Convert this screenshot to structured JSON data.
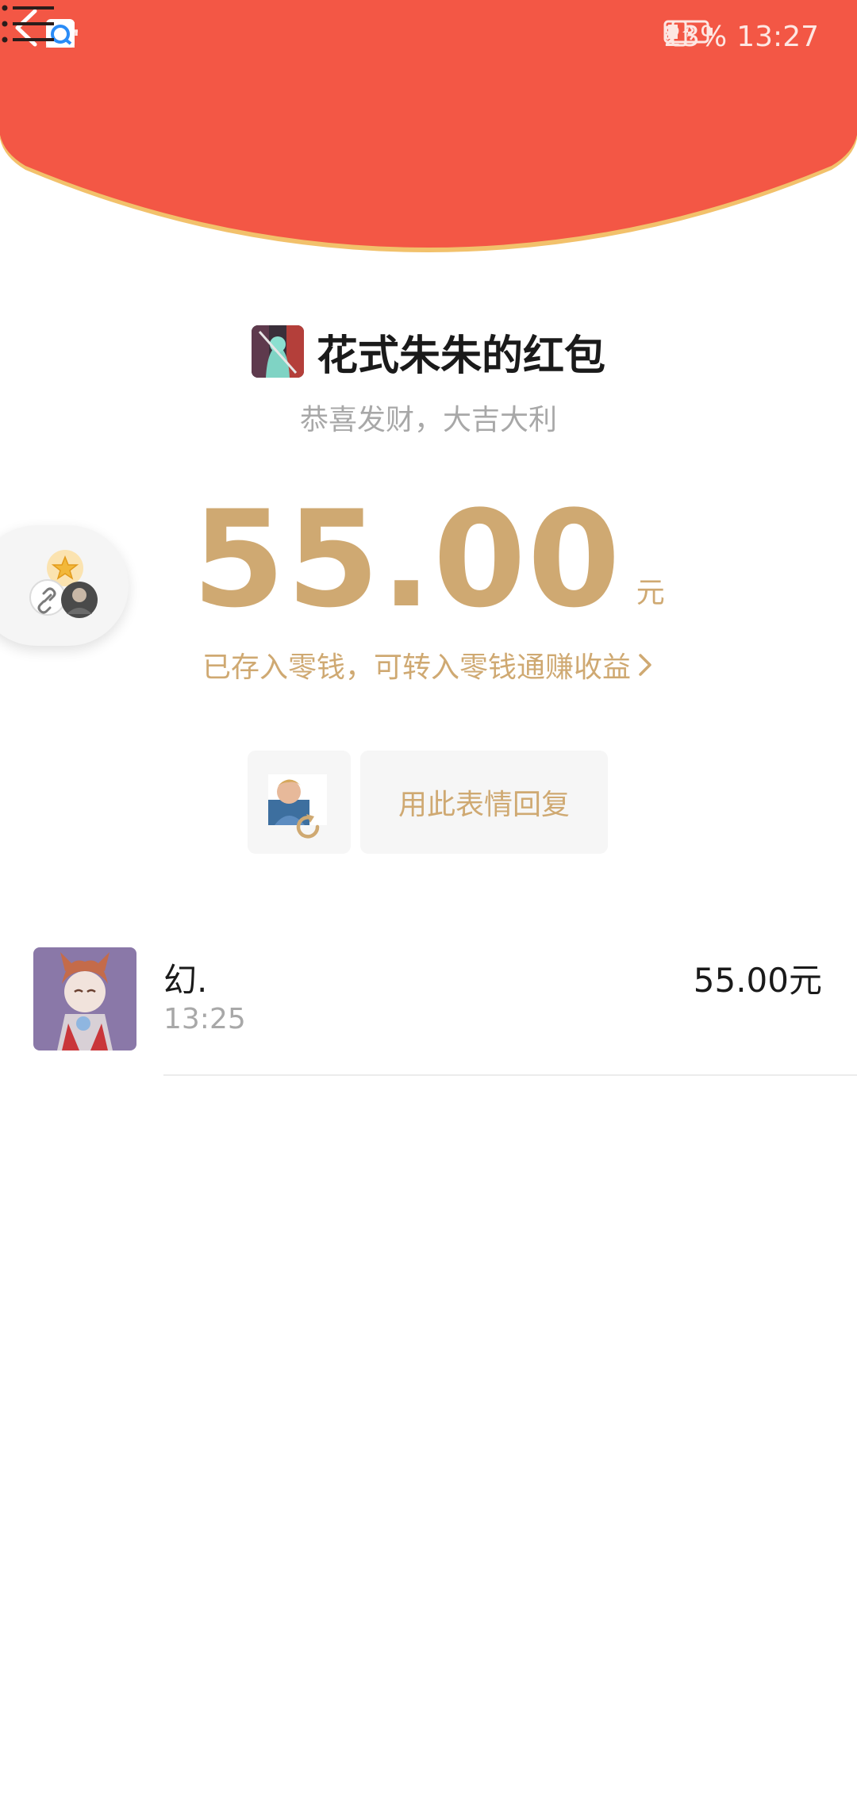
{
  "status_bar": {
    "network": "4G",
    "battery": "23%",
    "time": "13:27"
  },
  "envelope": {
    "title": "花式朱朱的红包",
    "wish": "恭喜发财，大吉大利",
    "amount": "55.00",
    "unit": "元",
    "stored_note": "已存入零钱，可转入零钱通赚收益"
  },
  "reply": {
    "button_label": "用此表情回复"
  },
  "records": [
    {
      "name": "幻.",
      "time": "13:25",
      "amount": "55.00元"
    }
  ],
  "colors": {
    "header_red": "#f35745",
    "gold": "#cfa972",
    "rim": "#f2c16b"
  }
}
